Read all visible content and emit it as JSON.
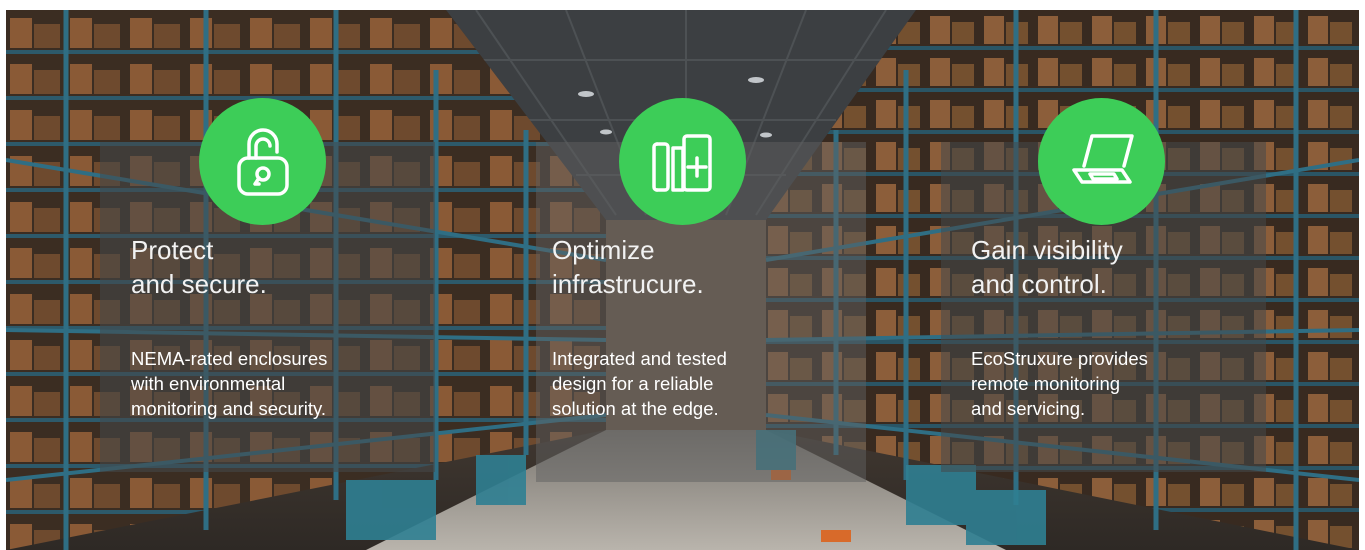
{
  "features": [
    {
      "icon": "unlocked-padlock-icon",
      "heading_lines": [
        "Protect",
        "and secure."
      ],
      "desc_lines": [
        "NEMA-rated enclosures",
        "with environmental",
        "monitoring and security."
      ]
    },
    {
      "icon": "modular-panels-plus-icon",
      "heading_lines": [
        "Optimize",
        "infrastrucure."
      ],
      "desc_lines": [
        "Integrated and tested",
        "design for a reliable",
        "solution at the edge."
      ]
    },
    {
      "icon": "laptop-icon",
      "heading_lines": [
        "Gain visibility",
        "and control."
      ],
      "desc_lines": [
        "EcoStruxure provides",
        "remote monitoring",
        "and servicing."
      ]
    }
  ],
  "colors": {
    "icon_circle": "#3dcd58",
    "panel_overlay": "rgba(70,72,74,0.55)",
    "text": "#ffffff"
  }
}
